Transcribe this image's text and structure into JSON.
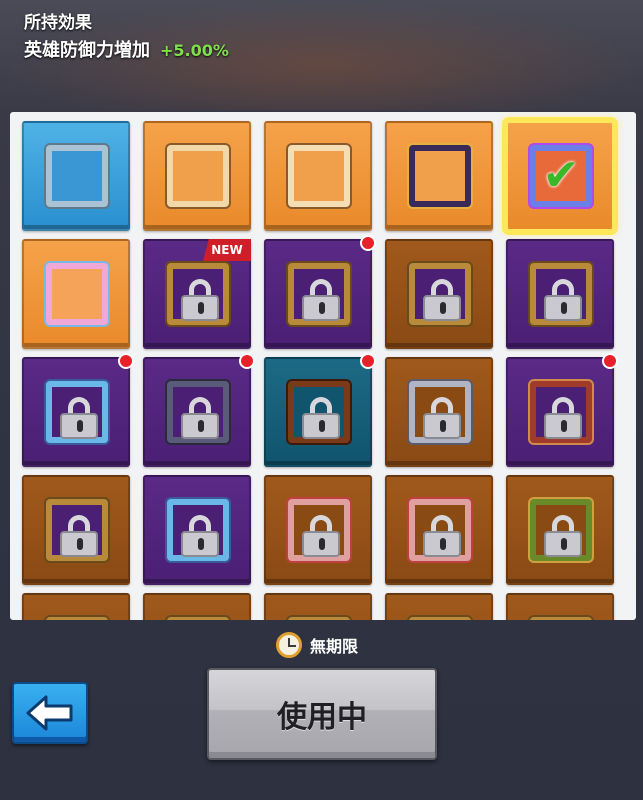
{
  "effect": {
    "title": "所持効果",
    "stat_name": "英雄防御力増加",
    "stat_value": "+5.00%"
  },
  "grid": {
    "new_badge": "NEW",
    "cells": [
      {
        "bg": "blue",
        "frame": "simple",
        "locked": false,
        "selected": false,
        "dot": false,
        "new": false
      },
      {
        "bg": "orange",
        "frame": "desert",
        "locked": false,
        "selected": false,
        "dot": false,
        "new": false
      },
      {
        "bg": "orange",
        "frame": "party",
        "locked": false,
        "selected": false,
        "dot": false,
        "new": false
      },
      {
        "bg": "orange",
        "frame": "halloween",
        "locked": false,
        "selected": false,
        "dot": false,
        "new": false
      },
      {
        "bg": "orange",
        "frame": "neon",
        "locked": false,
        "selected": true,
        "dot": false,
        "new": false
      },
      {
        "bg": "orange",
        "frame": "candy",
        "locked": false,
        "selected": false,
        "dot": false,
        "new": false
      },
      {
        "bg": "purple",
        "frame": "gold",
        "locked": true,
        "selected": false,
        "dot": false,
        "new": true
      },
      {
        "bg": "purple",
        "frame": "gold",
        "locked": true,
        "selected": false,
        "dot": true,
        "new": false
      },
      {
        "bg": "brown",
        "frame": "gold",
        "locked": true,
        "selected": false,
        "dot": false,
        "new": false
      },
      {
        "bg": "purple",
        "frame": "gold",
        "locked": true,
        "selected": false,
        "dot": false,
        "new": false
      },
      {
        "bg": "purple",
        "frame": "ice",
        "locked": true,
        "selected": false,
        "dot": true,
        "new": false
      },
      {
        "bg": "purple",
        "frame": "dark",
        "locked": true,
        "selected": false,
        "dot": true,
        "new": false
      },
      {
        "bg": "teal",
        "frame": "bronze",
        "locked": true,
        "selected": false,
        "dot": true,
        "new": false
      },
      {
        "bg": "brown",
        "frame": "silver",
        "locked": true,
        "selected": false,
        "dot": false,
        "new": false
      },
      {
        "bg": "purple",
        "frame": "red",
        "locked": true,
        "selected": false,
        "dot": true,
        "new": false
      },
      {
        "bg": "brown",
        "frame": "gold",
        "locked": true,
        "selected": false,
        "dot": false,
        "new": false
      },
      {
        "bg": "purple",
        "frame": "ice",
        "locked": true,
        "selected": false,
        "dot": false,
        "new": false
      },
      {
        "bg": "brown",
        "frame": "rose",
        "locked": true,
        "selected": false,
        "dot": false,
        "new": false
      },
      {
        "bg": "brown",
        "frame": "rose",
        "locked": true,
        "selected": false,
        "dot": false,
        "new": false
      },
      {
        "bg": "brown",
        "frame": "vine",
        "locked": true,
        "selected": false,
        "dot": false,
        "new": false
      },
      {
        "bg": "brown",
        "frame": "gold",
        "locked": true,
        "selected": false,
        "dot": false,
        "new": false
      },
      {
        "bg": "brown",
        "frame": "gold",
        "locked": true,
        "selected": false,
        "dot": false,
        "new": false
      },
      {
        "bg": "brown",
        "frame": "gold",
        "locked": true,
        "selected": false,
        "dot": false,
        "new": false
      },
      {
        "bg": "brown",
        "frame": "gold",
        "locked": true,
        "selected": false,
        "dot": false,
        "new": false
      },
      {
        "bg": "brown",
        "frame": "gold",
        "locked": true,
        "selected": false,
        "dot": false,
        "new": false
      }
    ]
  },
  "duration": {
    "icon": "clock-icon",
    "label": "無期限"
  },
  "buttons": {
    "back_icon": "arrow-left-icon",
    "use_label": "使用中"
  },
  "colors": {
    "selected_outline": "#ffe75a",
    "stat_value": "#7ee04a",
    "check": "#3ab82a",
    "notification_dot": "#e8202a",
    "back_button": "#1a86d8"
  }
}
